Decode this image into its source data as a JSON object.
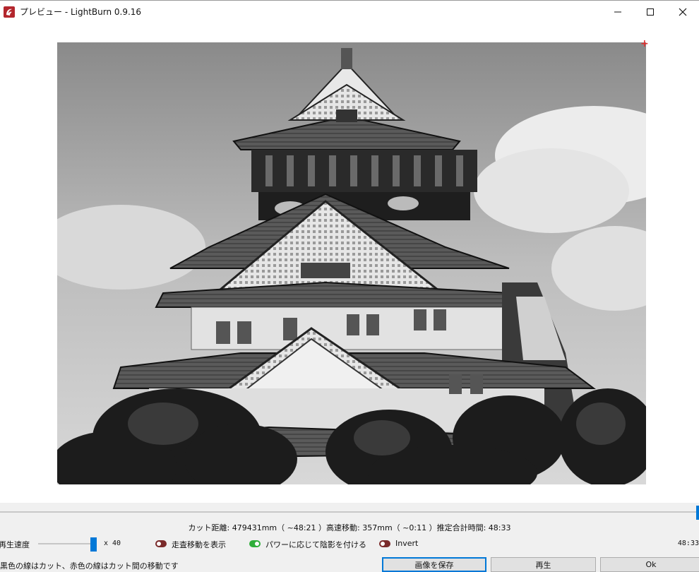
{
  "window": {
    "title": "プレビュー - LightBurn 0.9.16",
    "controls": {
      "minimize": "—",
      "maximize": "☐",
      "close": "✕"
    }
  },
  "preview": {
    "description_icon": "laser-preview-image",
    "origin_marker": "+"
  },
  "scrubber": {
    "progress": 1.0
  },
  "stats": {
    "text": "カット距離: 479431mm（ ~48:21 ）高速移動: 357mm（ ~0:11 ）推定合計時間: 48:33"
  },
  "playback": {
    "speed_label": "再生速度",
    "speed_multiplier": "x 40",
    "speed_fraction": 0.97,
    "show_traversal_label": "走査移動を表示",
    "show_traversal_on": false,
    "shade_by_power_label": "パワーに応じて陰影を付ける",
    "shade_by_power_on": true,
    "invert_label": "Invert",
    "invert_on": false,
    "elapsed": "48:33"
  },
  "status": {
    "legend_text": "黒色の線はカット、赤色の線はカット間の移動です"
  },
  "buttons": {
    "save_image": "画像を保存",
    "play": "再生",
    "ok": "Ok"
  },
  "colors": {
    "accent": "#0078d7",
    "toggle_off": "#7a2a2a",
    "toggle_on": "#2fae3a",
    "origin_marker": "#e03030"
  }
}
